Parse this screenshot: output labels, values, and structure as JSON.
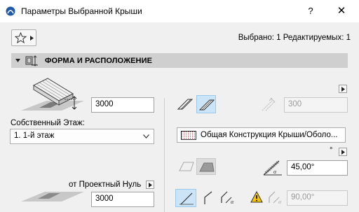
{
  "window": {
    "title": "Параметры Выбранной Крыши",
    "help_label": "?",
    "close_label": "✕"
  },
  "header": {
    "selection_info": "Выбрано: 1 Редактируемых: 1"
  },
  "section": {
    "title": "ФОРМА И РАСПОЛОЖЕНИЕ"
  },
  "left": {
    "height_value": "3000",
    "floor_label": "Собственный Этаж:",
    "floor_value": "1. 1-й этаж",
    "reference_label": "от Проектный Нуль",
    "offset_value": "3000"
  },
  "right": {
    "thickness_value": "300",
    "structure_value": "Общая Конструкция Крыши/Оболо...",
    "degree_symbol": "°",
    "angle_value": "45,00°",
    "edge_angle_value": "90,00°"
  },
  "colors": {
    "accent": "#0078d7",
    "toggle_on_bg": "#cce4f7",
    "section_bar": "#cfcfcf",
    "warning": "#f5c400"
  },
  "icons": [
    "archicad-logo-icon",
    "star-icon",
    "roof-form-icon",
    "close-icon",
    "warning-icon",
    "angle-icon"
  ]
}
